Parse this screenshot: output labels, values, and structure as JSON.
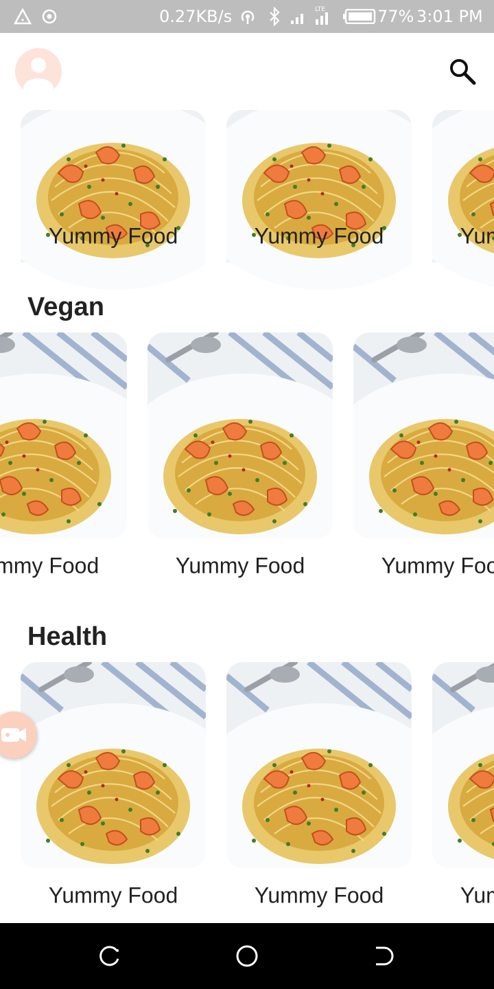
{
  "status_bar": {
    "network_speed": "0.27KB/s",
    "network_type": "LTE",
    "battery_percent": "77%",
    "time": "3:01 PM",
    "icons": [
      "alert-triangle-icon",
      "target-icon",
      "hotspot-icon",
      "bluetooth-icon",
      "signal-icon",
      "lte-signal-icon",
      "battery-icon"
    ]
  },
  "app_bar": {
    "avatar_icon": "person-icon",
    "search_icon": "search-icon"
  },
  "sections": [
    {
      "title": "",
      "cards": [
        {
          "label": "Yummy Food"
        },
        {
          "label": "Yummy Food"
        },
        {
          "label": "Yummy Food"
        }
      ]
    },
    {
      "title": "Vegan",
      "cards": [
        {
          "label": "Yummy Food"
        },
        {
          "label": "Yummy Food"
        },
        {
          "label": "Yummy Food"
        }
      ]
    },
    {
      "title": "Health",
      "cards": [
        {
          "label": "Yummy Food"
        },
        {
          "label": "Yummy Food"
        },
        {
          "label": "Yummy Food"
        }
      ]
    }
  ],
  "floating_button": {
    "icon": "video-camera-icon"
  },
  "nav_bar": {
    "icons": [
      "recent-apps-icon",
      "home-icon",
      "back-icon"
    ]
  },
  "colors": {
    "status_bar_bg": "#bdbdbd",
    "avatar_bg": "#fde3d9",
    "accent": "#f4a98c",
    "text": "#222222",
    "nav_bar_bg": "#000000"
  }
}
